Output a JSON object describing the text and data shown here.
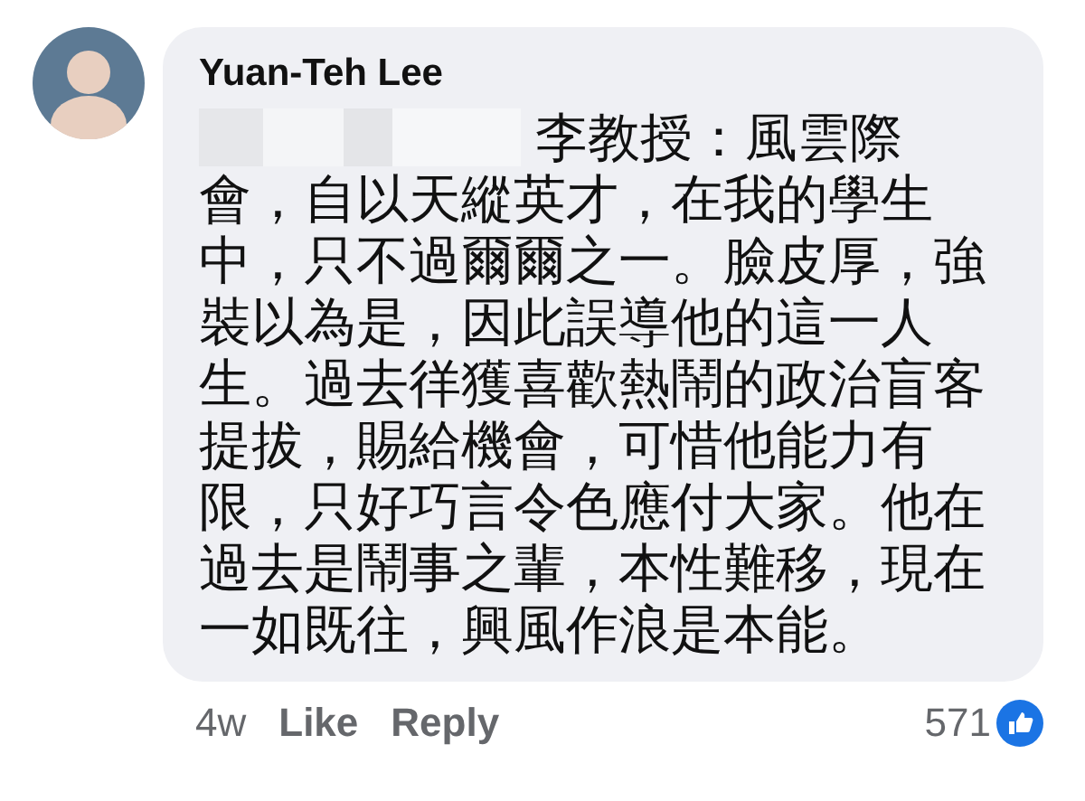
{
  "comment": {
    "author": "Yuan-Teh Lee",
    "text_lines": [
      "李教授：風雲際",
      "會，自以天縱英才，在我的學生",
      "中，只不過爾爾之一。臉皮厚，強",
      "裝以為是，因此誤導他的這一人",
      "生。過去徉獲喜歡熱鬧的政治盲客",
      "提拔，賜給機會，可惜他能力有",
      "限，只好巧言令色應付大家。他在",
      "過去是鬧事之輩，本性難移，現在",
      "一如既往，興風作浪是本能。"
    ],
    "time": "4w",
    "actions": [
      "Like",
      "Reply"
    ],
    "reaction_count": "571"
  }
}
